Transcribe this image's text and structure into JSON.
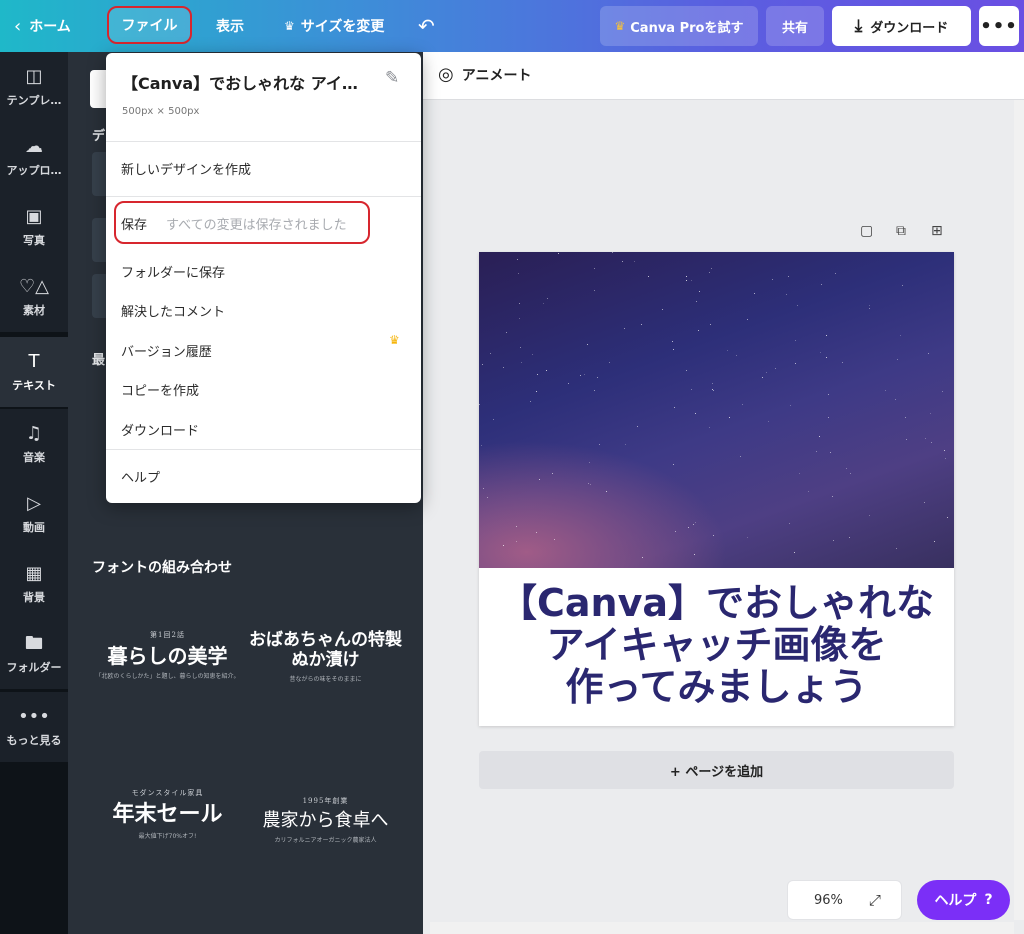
{
  "topbar": {
    "home": "ホーム",
    "file": "ファイル",
    "view": "表示",
    "resize": "サイズを変更",
    "pro": "Canva Proを試す",
    "share": "共有",
    "download": "ダウンロード"
  },
  "rail": {
    "items": [
      {
        "label": "テンプレ…",
        "icon": "template-icon"
      },
      {
        "label": "アップロ…",
        "icon": "upload-icon"
      },
      {
        "label": "写真",
        "icon": "photo-icon"
      },
      {
        "label": "素材",
        "icon": "elements-icon"
      },
      {
        "label": "テキスト",
        "icon": "text-icon"
      },
      {
        "label": "音楽",
        "icon": "music-icon"
      },
      {
        "label": "動画",
        "icon": "video-icon"
      },
      {
        "label": "背景",
        "icon": "background-icon"
      },
      {
        "label": "フォルダー",
        "icon": "folder-icon"
      },
      {
        "label": "もっと見る",
        "icon": "more-icon"
      }
    ]
  },
  "panel": {
    "frag1": "デ",
    "frag2": "最",
    "font_combos_heading": "フォントの組み合わせ",
    "combos": [
      {
        "small": "第1回2話",
        "big": "暮らしの美学",
        "tiny": "「北欧のくらしかた」と題し、暮らしの知恵を紹介。"
      },
      {
        "small": "",
        "big": "おばあちゃんの特製ぬか漬け",
        "tiny": "昔ながらの味をそのままに"
      },
      {
        "small": "モダンスタイル家具",
        "big": "年末セール",
        "tiny": "最大値下げ70%オフ!"
      },
      {
        "small": "1995年創業",
        "big": "農家から食卓へ",
        "tiny": "カリフォルニアオーガニック農家法人"
      }
    ]
  },
  "menu": {
    "title": "【Canva】でおしゃれな アイ…",
    "size": "500px × 500px",
    "new_design": "新しいデザインを作成",
    "save": "保存",
    "save_status": "すべての変更は保存されました",
    "save_to_folder": "フォルダーに保存",
    "resolved_comments": "解決したコメント",
    "version_history": "バージョン履歴",
    "make_copy": "コピーを作成",
    "download": "ダウンロード",
    "help": "ヘルプ"
  },
  "canvas": {
    "animate": "アニメート",
    "title_lines": [
      "【Canva】でおしゃれな",
      "アイキャッチ画像を",
      "作ってみましょう"
    ],
    "add_page": "+ ページを追加",
    "zoom": "96%",
    "help": "ヘルプ"
  },
  "colors": {
    "accent_purple": "#7b2ff7",
    "title_navy": "#2a2770",
    "highlight_red": "#d7262e"
  }
}
